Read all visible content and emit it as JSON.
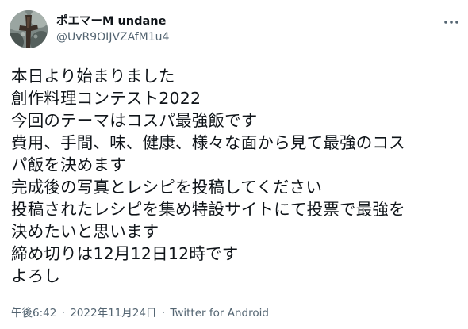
{
  "tweet": {
    "author": {
      "display_name": "ポエマーM undane",
      "handle": "@UvR9OIJVZAfM1u4"
    },
    "more_icon": "more-dots-icon",
    "text_lines": [
      "本日より始まりました",
      "創作料理コンテスト2022",
      "今回のテーマはコスパ最強飯です",
      "費用、手間、味、健康、様々な面から見て最強のコス",
      "パ飯を決めます",
      "完成後の写真とレシピを投稿してください",
      "投稿されたレシピを集め特設サイトにて投票で最強を",
      "決めたいと思います",
      "締め切りは12月12日12時です",
      "よろし"
    ],
    "meta": {
      "time": "午後6:42",
      "separator": "·",
      "date": "2022年11月24日",
      "source": "Twitter for Android"
    }
  },
  "colors": {
    "text_primary": "#0f1419",
    "text_secondary": "#536471",
    "background": "#ffffff"
  }
}
